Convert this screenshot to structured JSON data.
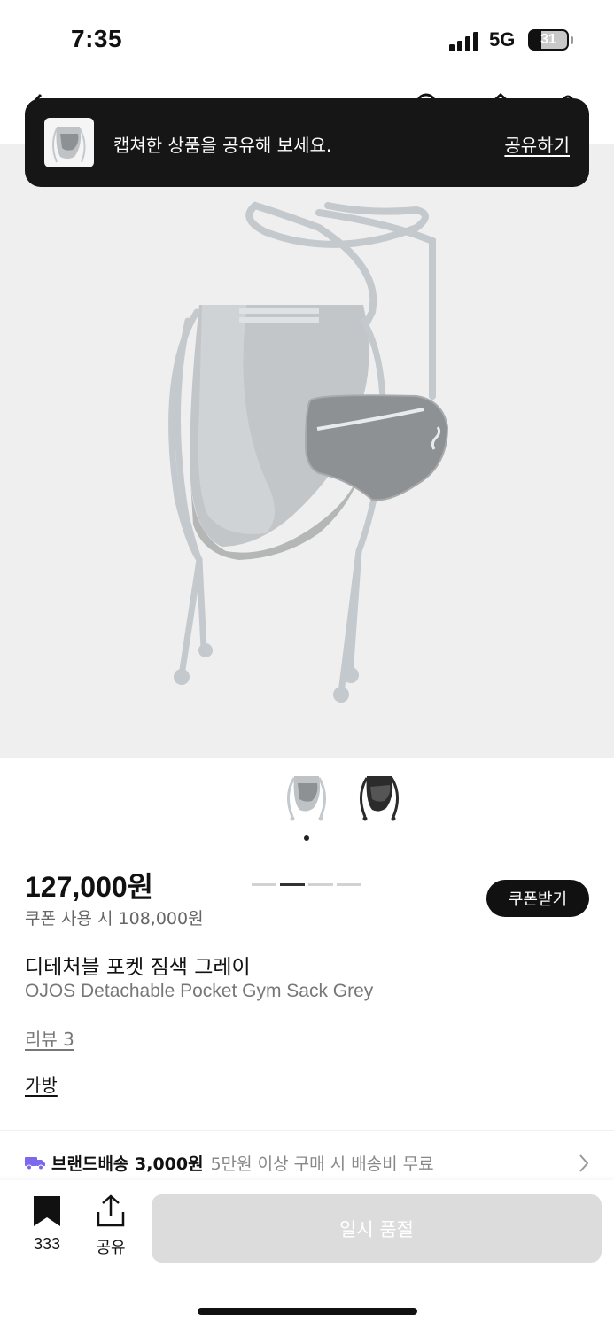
{
  "status_bar": {
    "time": "7:35",
    "network": "5G",
    "battery_level": "31",
    "battery_fraction": 0.31
  },
  "nav": {
    "icons": [
      "back-icon",
      "search-icon",
      "home-icon",
      "cart-icon"
    ]
  },
  "toast": {
    "message": "캡쳐한 상품을 공유해 보세요.",
    "action_label": "공유하기"
  },
  "gallery": {
    "page_count": 4,
    "active_page": 2,
    "thumbnails": [
      {
        "color": "#b9bec3",
        "selected": true
      },
      {
        "color": "#2b2b2b",
        "selected": false
      }
    ]
  },
  "product": {
    "price": "127,000원",
    "coupon_price": "쿠폰 사용 시 108,000원",
    "coupon_button": "쿠폰받기",
    "name_ko": "디테처블 포켓 짐색 그레이",
    "name_en": "OJOS Detachable Pocket Gym Sack Grey",
    "review_link": "리뷰 3",
    "category": "가방"
  },
  "shipping": {
    "label": "브랜드배송 3,000원",
    "condition": "5만원 이상 구매 시 배송비 무료",
    "icon_color": "#7b68ee"
  },
  "bottom_bar": {
    "bookmark_count": "333",
    "share_label": "공유",
    "soldout_label": "일시 품절"
  }
}
